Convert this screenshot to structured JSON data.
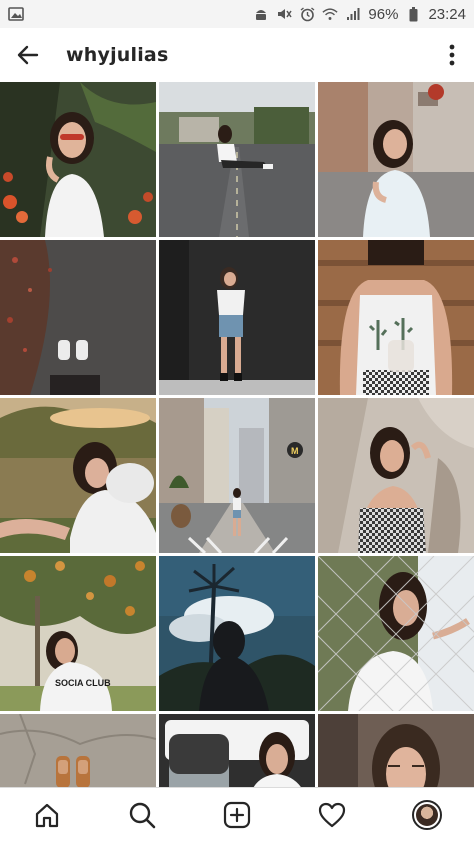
{
  "status_bar": {
    "battery_percent": "96%",
    "time": "23:24",
    "icons": [
      "image-icon",
      "android-icon",
      "mute-icon",
      "alarm-icon",
      "wifi-icon",
      "signal-icon",
      "battery-icon"
    ]
  },
  "header": {
    "username": "whyjulias",
    "back_icon": "back-arrow-icon",
    "more_icon": "more-vertical-icon"
  },
  "posts": [
    {
      "scene": "portrait-flowers",
      "text": ""
    },
    {
      "scene": "street-sitting",
      "text": ""
    },
    {
      "scene": "street-portrait",
      "text": ""
    },
    {
      "scene": "shoes-pavement",
      "text": ""
    },
    {
      "scene": "black-wall",
      "text": ""
    },
    {
      "scene": "cactus-tank",
      "text": ""
    },
    {
      "scene": "lying-grass",
      "text": ""
    },
    {
      "scene": "city-street",
      "text": "M"
    },
    {
      "scene": "wall-shadow",
      "text": ""
    },
    {
      "scene": "tree-tee",
      "text": "SOCIA CLUB"
    },
    {
      "scene": "silhouette-sky",
      "text": ""
    },
    {
      "scene": "chain-fence",
      "text": ""
    },
    {
      "scene": "rock-sandals",
      "text": ""
    },
    {
      "scene": "car-seat",
      "text": ""
    },
    {
      "scene": "portrait-close",
      "text": ""
    }
  ],
  "bottom_nav": {
    "items": [
      {
        "name": "home",
        "icon": "home-icon"
      },
      {
        "name": "search",
        "icon": "search-icon"
      },
      {
        "name": "new-post",
        "icon": "add-post-icon"
      },
      {
        "name": "activity",
        "icon": "heart-icon"
      },
      {
        "name": "profile",
        "icon": "avatar-icon"
      }
    ]
  }
}
